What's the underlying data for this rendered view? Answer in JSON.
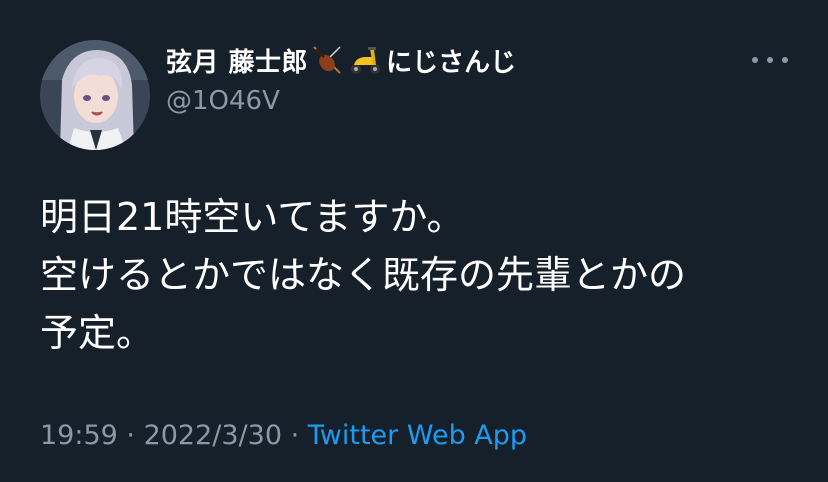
{
  "author": {
    "display_name": "弦月 藤士郎",
    "emoji_1": "violin-icon",
    "emoji_2": "scooter-icon",
    "affiliation": "にじさんじ",
    "handle": "@1O46V"
  },
  "menu": {
    "more_icon": "more-horizontal-icon"
  },
  "tweet": {
    "lines": [
      "明日21時空いてますか。",
      "空けるとかではなく既存の先輩とかの",
      "予定。"
    ]
  },
  "meta": {
    "time": "19:59",
    "separator_1": " · ",
    "date": "2022/3/30",
    "separator_2": " · ",
    "source": "Twitter Web App"
  },
  "colors": {
    "background": "#15202b",
    "text": "#ffffff",
    "secondary": "#8b98a5",
    "link": "#1d9bf0"
  }
}
